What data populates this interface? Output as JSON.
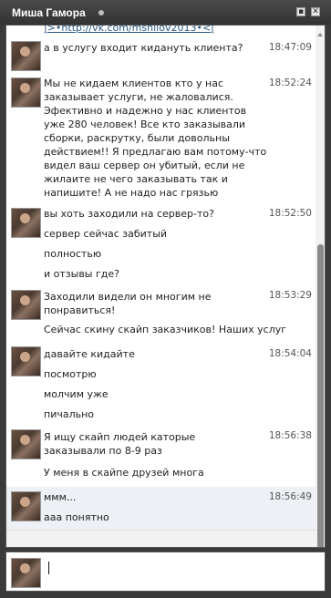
{
  "window": {
    "title": "Миша Гамора",
    "status": "online"
  },
  "messages": [
    {
      "lines": [
        "|>•http://vk.com/mshilov2013•<|"
      ],
      "time": "",
      "avatar": false
    },
    {
      "lines": [
        "а в услугу входит кидануть клиента?"
      ],
      "time": "18:47:09",
      "avatar": true
    },
    {
      "lines": [
        "Мы не кидаем клиентов кто у нас заказывает услуги, не жаловалися. Эфективно и надежно у нас клиентов уже 280 человек! Все кто заказывали сборки, раскрутку, были довольны действием!! Я предлагаю вам потому-что видел ваш сервер он убитый, если не жилаите не чего заказывать так и напишите! А не надо нас грязью поливать."
      ],
      "time": "18:52:24",
      "avatar": true
    },
    {
      "lines": [
        "вы хоть заходили на сервер-то?",
        "сервер сейчас забитый",
        "полностью",
        "и отзывы где?"
      ],
      "time": "18:52:50",
      "avatar": true
    },
    {
      "lines": [
        "Заходили видели он многим не понравиться!",
        "Сейчас скину скайп заказчиков! Наших услуг"
      ],
      "time": "18:53:29",
      "avatar": true
    },
    {
      "lines": [
        "давайте кидайте",
        "посмотрю",
        "молчим уже",
        "пичально"
      ],
      "time": "18:54:04",
      "avatar": true
    },
    {
      "lines": [
        "Я ищу скайп людей каторые заказывали по 8-9 раз",
        "У меня в скайпе друзей многа"
      ],
      "time": "18:56:38",
      "avatar": true
    },
    {
      "lines": [
        "ммм...",
        "ааа понятно"
      ],
      "time": "18:56:49",
      "avatar": true
    }
  ]
}
